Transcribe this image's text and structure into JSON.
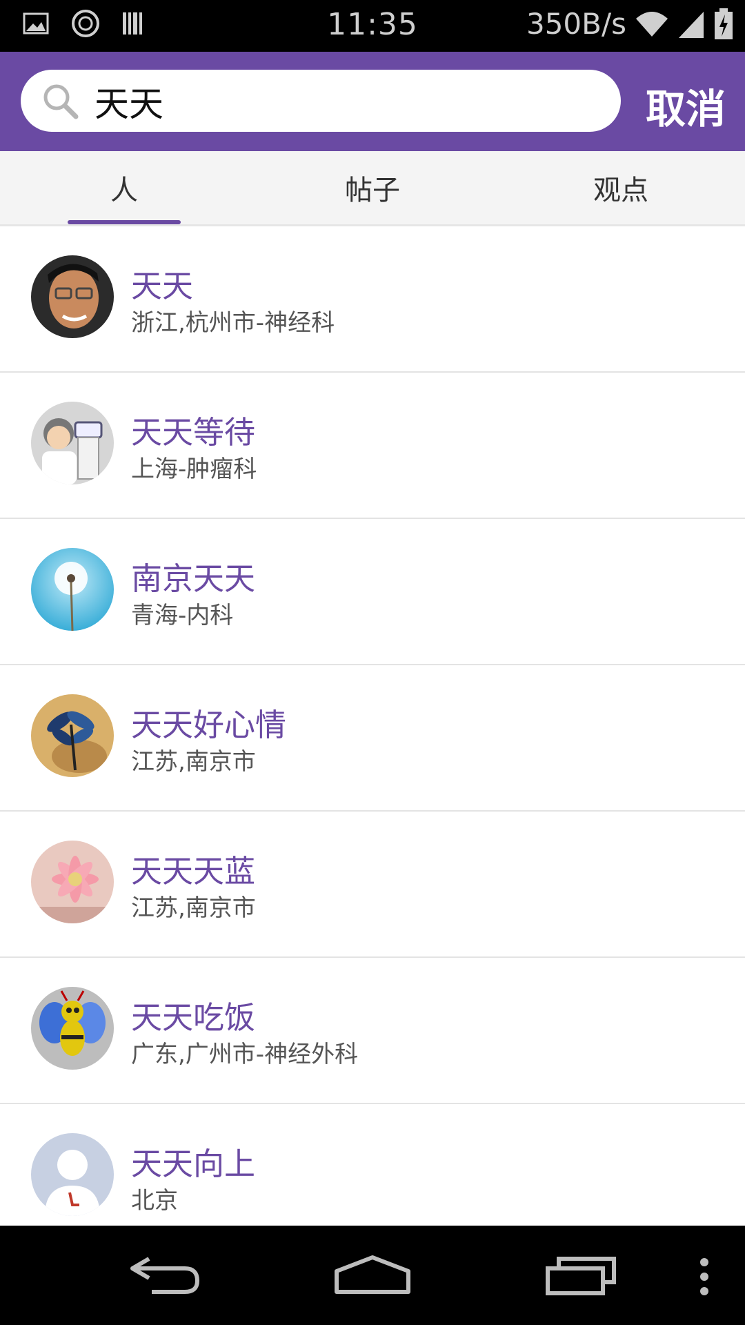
{
  "status_bar": {
    "time": "11:35",
    "speed": "350B/s"
  },
  "search": {
    "query": "天天",
    "cancel_label": "取消"
  },
  "tabs": [
    {
      "label": "人",
      "active": true
    },
    {
      "label": "帖子",
      "active": false
    },
    {
      "label": "观点",
      "active": false
    }
  ],
  "results": [
    {
      "name": "天天",
      "location": "浙江,杭州市-神经科",
      "avatar": "man-with-glasses-avatar"
    },
    {
      "name": "天天等待",
      "location": "上海-肿瘤科",
      "avatar": "cartoon-doctor-avatar"
    },
    {
      "name": "南京天天",
      "location": "青海-内科",
      "avatar": "dandelion-avatar"
    },
    {
      "name": "天天好心情",
      "location": "江苏,南京市",
      "avatar": "dragonfly-avatar"
    },
    {
      "name": "天天天蓝",
      "location": "江苏,南京市",
      "avatar": "pink-flower-avatar"
    },
    {
      "name": "天天吃饭",
      "location": "广东,广州市-神经外科",
      "avatar": "bee-avatar"
    },
    {
      "name": "天天向上",
      "location": "北京",
      "avatar": "default-avatar"
    }
  ],
  "colors": {
    "accent": "#6a4aa3",
    "background": "#ffffff",
    "divider": "#e3e3e3"
  }
}
